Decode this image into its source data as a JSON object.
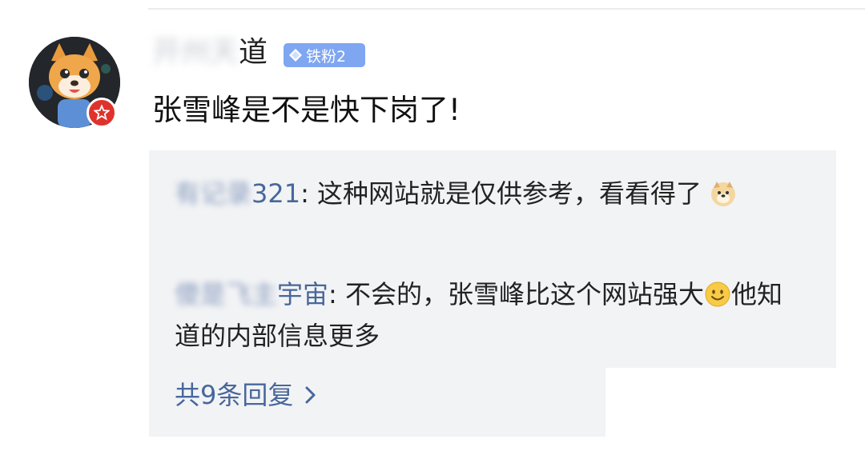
{
  "comment": {
    "username_blurred": "开州天",
    "username_visible": "道",
    "badge": {
      "label": "铁粉2",
      "color": "#7fa6f0"
    },
    "text": "张雪峰是不是快下岗了!"
  },
  "replies": [
    {
      "name_blurred": "有记录",
      "name_visible": "321",
      "separator": ": ",
      "text_before_emoji": "这种网站就是仅供参考，看看得了",
      "emoji": "doge-emoji",
      "text_after_emoji": ""
    },
    {
      "name_blurred": "傻是飞主",
      "name_visible": "宇宙",
      "separator": ": ",
      "text_before_emoji": "不会的，张雪峰比这个网站强大",
      "emoji": "smile-emoji",
      "text_after_emoji": "他知道的内部信息更多"
    }
  ],
  "more_replies": {
    "label": "共9条回复",
    "icon": "chevron-right-icon"
  },
  "colors": {
    "link_blue": "#48679c",
    "reply_bg": "#f2f3f5",
    "verified_red": "#e0322c"
  }
}
